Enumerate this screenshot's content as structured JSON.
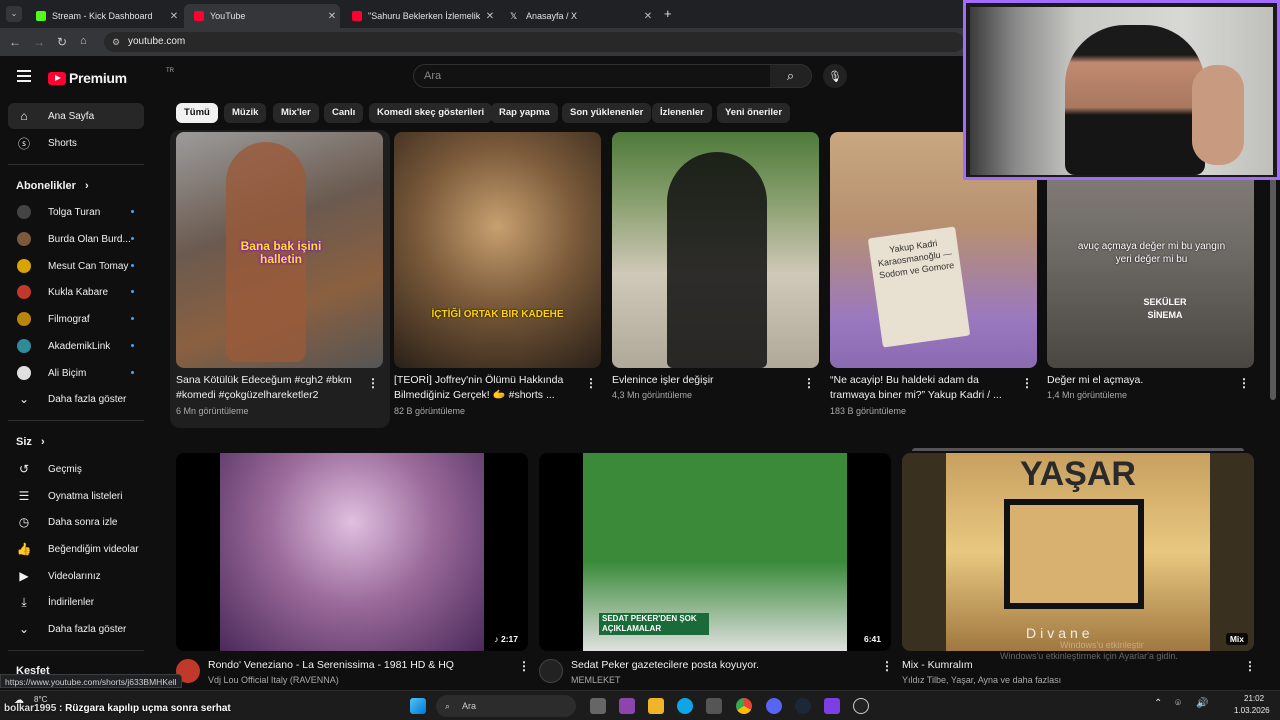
{
  "browser": {
    "tabs": [
      {
        "title": "Stream - Kick Dashboard",
        "color": "#53fc18",
        "active": false
      },
      {
        "title": "YouTube",
        "color": "#ff0033",
        "active": true
      },
      {
        "title": "\"Sahuru Beklerken İzlemelik Ed",
        "color": "#ff0033",
        "active": false
      },
      {
        "title": "Anasayfa / X",
        "color": "#e7e9ea",
        "active": false
      }
    ],
    "new_tab": "+",
    "url": "youtube.com",
    "status_url": "https://www.youtube.com/shorts/j633BMHKell"
  },
  "header": {
    "logo_text": "Premium",
    "logo_sup": "TR",
    "search_placeholder": "Ara"
  },
  "sidebar": {
    "main": [
      {
        "label": "Ana Sayfa",
        "icon": "home-icon",
        "active": true
      },
      {
        "label": "Shorts",
        "icon": "shorts-icon",
        "active": false
      }
    ],
    "subs_heading": "Abonelikler",
    "subs": [
      {
        "label": "Tolga Turan",
        "color": "#444"
      },
      {
        "label": "Burda Olan Burd...",
        "color": "#7a5a3a"
      },
      {
        "label": "Mesut Can Tomay",
        "color": "#d9a400"
      },
      {
        "label": "Kukla Kabare",
        "color": "#c0392b"
      },
      {
        "label": "Filmograf",
        "color": "#b8860b"
      },
      {
        "label": "AkademikLink",
        "color": "#2e8b9a"
      },
      {
        "label": "Ali Biçim",
        "color": "#e0e0e0"
      }
    ],
    "subs_more": "Daha fazla göster",
    "you_heading": "Siz",
    "you": [
      {
        "label": "Geçmiş",
        "icon": "history-icon"
      },
      {
        "label": "Oynatma listeleri",
        "icon": "playlists-icon"
      },
      {
        "label": "Daha sonra izle",
        "icon": "watch-later-icon"
      },
      {
        "label": "Beğendiğim videolar",
        "icon": "like-icon"
      },
      {
        "label": "Videolarınız",
        "icon": "your-videos-icon"
      },
      {
        "label": "İndirilenler",
        "icon": "downloads-icon"
      },
      {
        "label": "Daha fazla göster",
        "icon": "chevron-down-icon"
      }
    ],
    "explore_heading": "Keşfet"
  },
  "chips": [
    "Tümü",
    "Müzik",
    "Mix'ler",
    "Canlı",
    "Komedi skeç gösterileri",
    "Rap yapma",
    "Son yüklenenler",
    "İzlenenler",
    "Yeni öneriler"
  ],
  "shorts": [
    {
      "title": "Sana Kötülük Edeceğum #cgh2 #bkm #komedi #çokgüzelhareketler2",
      "views": "6 Mn görüntüleme",
      "overlay": "Bana bak işini halletin",
      "bg": "#6b5a4f"
    },
    {
      "title": "[TEORİ] Joffrey'nin Ölümü Hakkında Bilmediğiniz Gerçek! 🫱 #shorts ...",
      "views": "82 B görüntüleme",
      "overlay": "İÇTİĞİ ORTAK BIR KADEHE",
      "bg": "#7a6a4a"
    },
    {
      "title": "Evlenince işler değişir",
      "views": "4,3 Mn görüntüleme",
      "overlay": "",
      "bg": "#8aa070"
    },
    {
      "title": "“Ne acayip! Bu haldeki adam da tramwaya biner mi?” Yakup Kadri / ...",
      "views": "183 B görüntüleme",
      "overlay": "",
      "book": "Yakup Kadri Karaosmanoğlu — Sodom ve Gomore",
      "bg": "#b79070"
    },
    {
      "title": "Değer mi el açmaya.",
      "views": "1,4 Mn görüntüleme",
      "overlay": "avuç açmaya değer mi bu yangın yeri değer mi bu",
      "brand": "SEKÜLER SİNEMA",
      "bg": "#6e6a66"
    }
  ],
  "videos": [
    {
      "title": "Rondo' Veneziano - La Serenissima - 1981 HD & HQ",
      "channel": "Vdj Lou Official Italy (RAVENNA)",
      "duration": "♪ 2:17",
      "bg": "#9a6a9a"
    },
    {
      "title": "Sedat Peker gazetecilere posta koyuyor.",
      "channel": "MEMLEKET",
      "duration": "6:41",
      "bg": "#3a8a3a",
      "caption": "SEDAT PEKER'DEN ŞOK AÇIKLAMALAR"
    },
    {
      "title": "Mix - Kumralım",
      "channel": "Yıldız Tilbe, Yaşar, Ayna ve daha fazlası",
      "duration": "Mix",
      "bg": "#c8a060",
      "thumb_text": "YAŞAR",
      "thumb_sub": "Divane"
    }
  ],
  "overlay": {
    "chat_user": "bolkar1995",
    "chat_msg": "Rüzgara kapılıp uçma sonra serhat",
    "watermark_line1": "Windows'u etkinleştir",
    "watermark_line2": "Windows'u etkinleştirmek için Ayarlar'a gidin."
  },
  "taskbar": {
    "weather": "8°C",
    "search": "Ara",
    "time": "21:02",
    "date": "1.03.2026"
  }
}
